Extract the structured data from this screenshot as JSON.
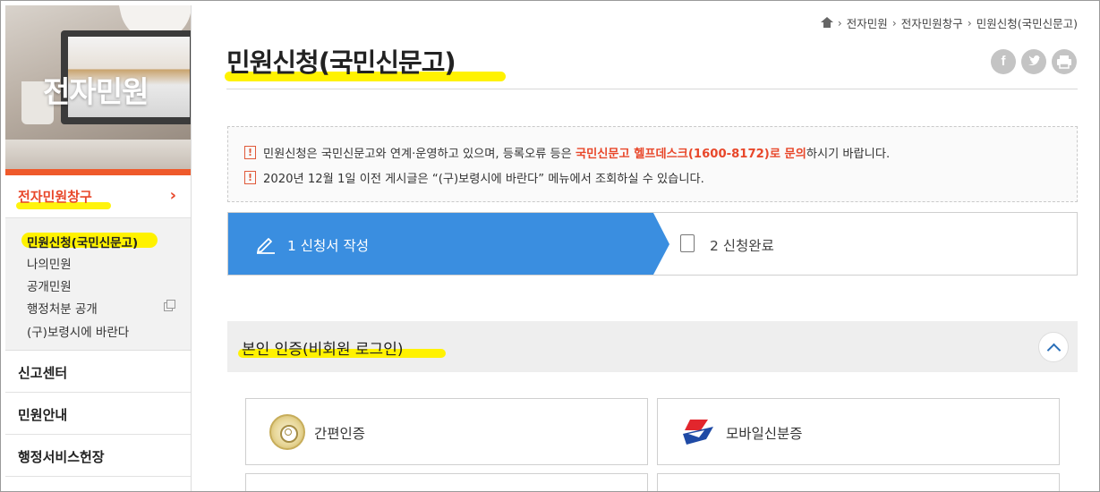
{
  "sidebar": {
    "hero_title": "전자민원",
    "active_menu": "전자민원창구",
    "submenu": [
      {
        "label": "민원신청(국민신문고)"
      },
      {
        "label": "나의민원"
      },
      {
        "label": "공개민원"
      },
      {
        "label": "행정처분 공개"
      },
      {
        "label": "(구)보령시에 바란다"
      }
    ],
    "menus": [
      "신고센터",
      "민원안내",
      "행정서비스헌장"
    ]
  },
  "breadcrumb": [
    "전자민원",
    "전자민원창구",
    "민원신청(국민신문고)"
  ],
  "page_title": "민원신청(국민신문고)",
  "share_icons": [
    "facebook-icon",
    "twitter-icon",
    "print-icon"
  ],
  "notice": {
    "line1_pre": "민원신청은 국민신문고와 연계·운영하고 있으며, 등록오류 등은 ",
    "line1_em": "국민신문고 헬프데스크(1600-8172)로 문의",
    "line1_post": "하시기 바랍니다.",
    "line2": "2020년 12월 1일 이전 게시글은 “(구)보령시에 바란다” 메뉴에서 조회하실 수 있습니다."
  },
  "steps": [
    {
      "label": "1 신청서 작성"
    },
    {
      "label": "2 신청완료"
    }
  ],
  "auth": {
    "title": "본인 인증(비회원 로그인)",
    "options": [
      {
        "label": "간편인증"
      },
      {
        "label": "모바일신분증"
      }
    ]
  },
  "colors": {
    "accent_orange": "#ef5a2b",
    "step_blue": "#3a8ee0",
    "highlight_yellow": "#fff200"
  }
}
